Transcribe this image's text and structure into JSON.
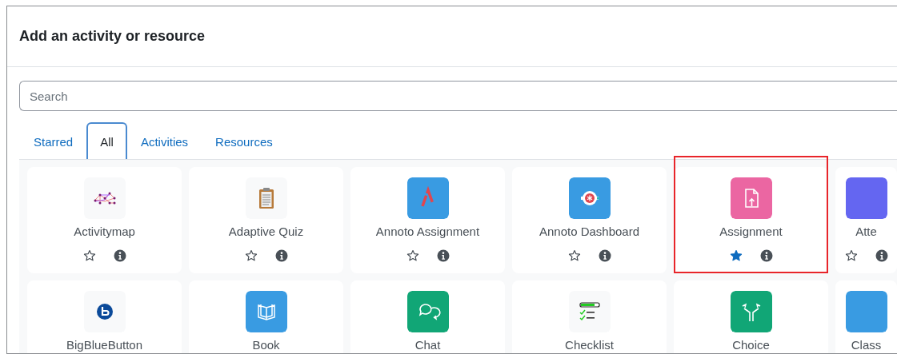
{
  "dialog": {
    "title": "Add an activity or resource"
  },
  "search": {
    "placeholder": "Search"
  },
  "tabs": [
    {
      "label": "Starred",
      "selected": false
    },
    {
      "label": "All",
      "selected": true
    },
    {
      "label": "Activities",
      "selected": false
    },
    {
      "label": "Resources",
      "selected": false
    }
  ],
  "activities": [
    {
      "name": "Activitymap",
      "starred": false,
      "highlighted": false
    },
    {
      "name": "Adaptive Quiz",
      "starred": false,
      "highlighted": false
    },
    {
      "name": "Annoto Assignment",
      "starred": false,
      "highlighted": false
    },
    {
      "name": "Annoto Dashboard",
      "starred": false,
      "highlighted": false
    },
    {
      "name": "Assignment",
      "starred": true,
      "highlighted": true
    },
    {
      "name": "Atte",
      "starred": false,
      "highlighted": false
    },
    {
      "name": "BigBlueButton",
      "highlighted": false
    },
    {
      "name": "Book",
      "highlighted": false
    },
    {
      "name": "Chat",
      "highlighted": false
    },
    {
      "name": "Checklist",
      "highlighted": false
    },
    {
      "name": "Choice",
      "highlighted": false
    },
    {
      "name": "Class",
      "highlighted": false
    }
  ]
}
